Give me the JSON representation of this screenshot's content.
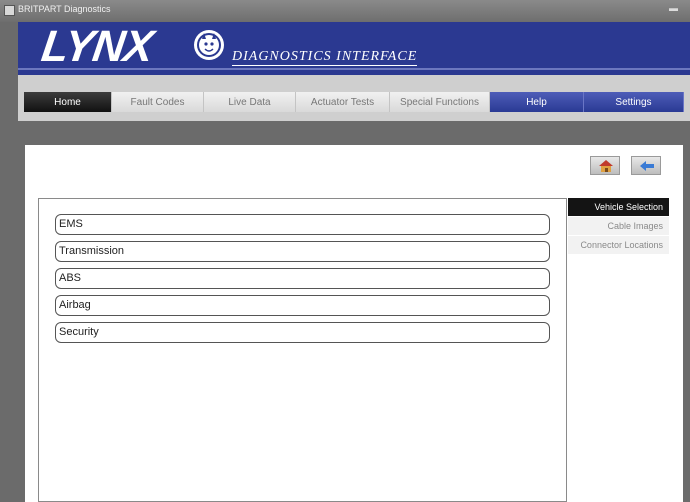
{
  "window": {
    "title": "BRITPART Diagnostics"
  },
  "header": {
    "logo_text": "LYNX",
    "subtitle": "DIAGNOSTICS INTERFACE"
  },
  "nav": {
    "tabs": [
      {
        "label": "Home",
        "state": "active"
      },
      {
        "label": "Fault Codes",
        "state": "normal"
      },
      {
        "label": "Live Data",
        "state": "normal"
      },
      {
        "label": "Actuator Tests",
        "state": "normal"
      },
      {
        "label": "Special Functions",
        "state": "normal"
      },
      {
        "label": "Help",
        "state": "highlight"
      },
      {
        "label": "Settings",
        "state": "highlight"
      }
    ]
  },
  "toolbar": {
    "home_icon": "home-icon",
    "back_icon": "back-arrow-icon"
  },
  "systems": [
    {
      "label": "EMS"
    },
    {
      "label": "Transmission"
    },
    {
      "label": "ABS"
    },
    {
      "label": "Airbag"
    },
    {
      "label": "Security"
    }
  ],
  "side_tabs": [
    {
      "label": "Vehicle Selection",
      "active": true
    },
    {
      "label": "Cable Images",
      "active": false
    },
    {
      "label": "Connector Locations",
      "active": false
    }
  ],
  "colors": {
    "brand_blue": "#2b3991",
    "active_tab": "#141414"
  }
}
